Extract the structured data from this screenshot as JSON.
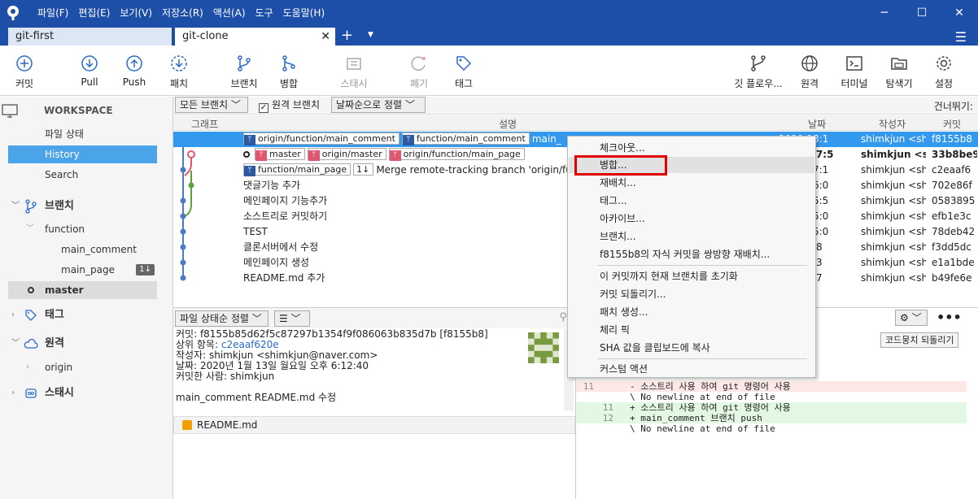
{
  "menu": [
    "파일(F)",
    "편집(E)",
    "보기(V)",
    "저장소(R)",
    "액션(A)",
    "도구",
    "도움말(H)"
  ],
  "tabs": [
    {
      "label": "git-first"
    },
    {
      "label": "git-clone"
    }
  ],
  "toolbar": {
    "commit": "커밋",
    "pull": "Pull",
    "push": "Push",
    "fetch": "패치",
    "branch": "브랜치",
    "merge": "병합",
    "stash": "스태시",
    "discard": "폐기",
    "tag": "태그",
    "gitflow": "깃 플로우...",
    "remote": "원격",
    "terminal": "터미널",
    "explorer": "탐색기",
    "settings": "설정"
  },
  "sidebar": {
    "workspace": "WORKSPACE",
    "file_status": "파일 상태",
    "history": "History",
    "search": "Search",
    "branches": "브랜치",
    "function_folder": "function",
    "main_comment": "main_comment",
    "main_page": "main_page",
    "main_page_badge": "1↓",
    "master": "master",
    "tags": "태그",
    "remotes": "원격",
    "origin": "origin",
    "stash": "스태시"
  },
  "filter": {
    "all_branches": "모든 브랜치",
    "remote_branches": "원격 브랜치",
    "sort": "날짜순으로 정렬",
    "skip": "건너뛰기:"
  },
  "columns": {
    "graph": "그래프",
    "desc": "설명",
    "date": "날짜",
    "author": "작성자",
    "commit": "커밋"
  },
  "history": [
    {
      "labels": [
        "origin/function/main_comment",
        "function/main_comment"
      ],
      "desc": "main_",
      "date": "2020 18:1",
      "author": "shimkjun <shi",
      "commit": "f8155b8"
    },
    {
      "labels": [
        "master",
        "origin/master",
        "origin/function/main_page"
      ],
      "desc": "",
      "date": "2020 17:5",
      "author": "shimkjun <sh",
      "commit": "33b8be9"
    },
    {
      "labels": [
        "function/main_page"
      ],
      "badge": "1↓",
      "desc": "Merge remote-tracking branch 'origin/functi",
      "date": "2020 17:1",
      "author": "shimkjun <shi",
      "commit": "c2eaaf6"
    },
    {
      "labels": [],
      "desc": "댓글기능 추가",
      "date": "2020 16:0",
      "author": "shimkjun <shi",
      "commit": "702e86f"
    },
    {
      "labels": [],
      "desc": "메인페이지 기능추가",
      "date": "2020 15:5",
      "author": "shimkjun <shi",
      "commit": "0583895"
    },
    {
      "labels": [],
      "desc": "소스트리로 커밋하기",
      "date": "2020 15:0",
      "author": "shimkjun <shi",
      "commit": "efb1e3c"
    },
    {
      "labels": [],
      "desc": "TEST",
      "date": "2020 15:0",
      "author": "shimkjun <shi",
      "commit": "78deb42"
    },
    {
      "labels": [],
      "desc": "클론서버에서 수정",
      "date": "20 22:48",
      "author": "shimkjun <shi",
      "commit": "f3dd5dc"
    },
    {
      "labels": [],
      "desc": "메인페이지 생성",
      "date": "20 16:33",
      "author": "shimkjun <shi",
      "commit": "e1a1bde"
    },
    {
      "labels": [],
      "desc": "README.md 추가",
      "date": "20 16:27",
      "author": "shimkjun <shi",
      "commit": "b49fe6e"
    }
  ],
  "bottom": {
    "file_sort": "파일 상태순 정렬",
    "commit_line": "커밋: f8155b85d62f5c87297b1354f9f086063b835d7b [f8155b8]",
    "parent_label": "상위 항목:",
    "parent_value": "c2eaaf620e",
    "author_line": "작성자: shimkjun <shimkjun@naver.com>",
    "date_line": "날짜: 2020년 1월 13일 월요일 오후 6:12:40",
    "committer_line": "커밋한 사람: shimkjun",
    "message": "main_comment README.md 수정",
    "file": "README.md"
  },
  "diff": {
    "revert_button": "코드뭉치 되돌리기",
    "lines": [
      {
        "type": "del",
        "ln1": "11",
        "ln2": "",
        "text": "- 소스트리 사용 하여 git 명령어 사용"
      },
      {
        "type": "ctx",
        "ln1": "",
        "ln2": "",
        "text": "\\ No newline at end of file"
      },
      {
        "type": "add",
        "ln1": "",
        "ln2": "11",
        "text": "+ 소스트리 사용 하여 git 명령어 사용"
      },
      {
        "type": "add",
        "ln1": "",
        "ln2": "12",
        "text": "+ main_comment 브랜치 push"
      },
      {
        "type": "ctx",
        "ln1": "",
        "ln2": "",
        "text": "\\ No newline at end of file"
      }
    ]
  },
  "context_menu": {
    "checkout": "체크아웃...",
    "merge": "병합...",
    "rebase": "재배치...",
    "tag": "태그...",
    "archive": "아카이브...",
    "branch": "브랜치...",
    "interactive_rebase": "f8155b8의 자식 커밋을 쌍방향 재배치...",
    "reset": "이 커밋까지 현재 브랜치를 초기화",
    "revert": "커밋 되돌리기...",
    "patch": "패치 생성...",
    "cherry_pick": "체리 픽",
    "copy_sha": "SHA 값을 클립보드에 복사",
    "custom_action": "커스텀 액션"
  },
  "colors": {
    "titlebar": "#1e4fa8",
    "selection": "#3399ee",
    "highlight": "#e00000"
  }
}
